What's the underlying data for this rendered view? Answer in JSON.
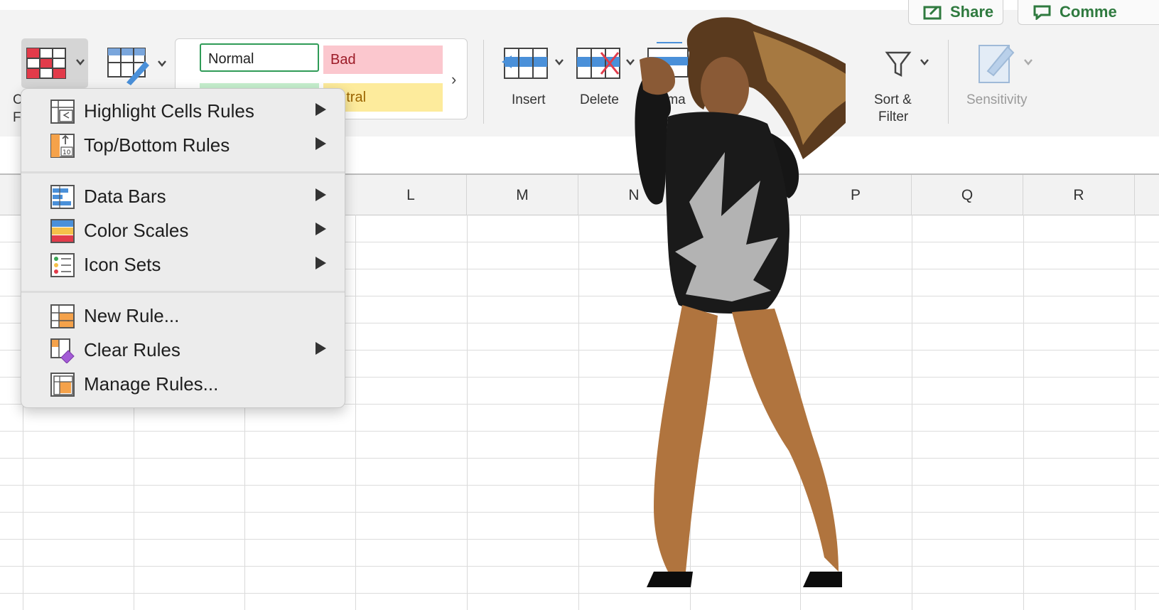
{
  "ribbon": {
    "top_buttons": {
      "share_label": "Share",
      "comments_label": "Comme"
    },
    "conditional_formatting_label_a": "C",
    "conditional_formatting_label_b": "F",
    "styles": {
      "normal": "Normal",
      "bad": "Bad",
      "neutral": "eutral",
      "more": "›"
    },
    "insert_label": "Insert",
    "delete_label": "Delete",
    "format_label": "rma",
    "sort_filter_label_1": "Sort &",
    "sort_filter_label_2": "Filter",
    "sensitivity_label": "Sensitivity"
  },
  "grid": {
    "columns": [
      "L",
      "M",
      "N",
      "P",
      "Q",
      "R"
    ]
  },
  "menu": {
    "items": [
      {
        "label": "Highlight Cells Rules",
        "icon": "highlight-cells-icon",
        "submenu": true
      },
      {
        "label": "Top/Bottom Rules",
        "icon": "top-bottom-icon",
        "submenu": true
      },
      {
        "label": "Data Bars",
        "icon": "data-bars-icon",
        "submenu": true
      },
      {
        "label": "Color Scales",
        "icon": "color-scales-icon",
        "submenu": true
      },
      {
        "label": "Icon Sets",
        "icon": "icon-sets-icon",
        "submenu": true
      },
      {
        "label": "New Rule...",
        "icon": "new-rule-icon",
        "submenu": false
      },
      {
        "label": "Clear Rules",
        "icon": "clear-rules-icon",
        "submenu": true
      },
      {
        "label": "Manage Rules...",
        "icon": "manage-rules-icon",
        "submenu": false
      }
    ]
  },
  "colors": {
    "accent_green": "#2f7a3f",
    "menu_background": "#ececec",
    "bad_fill": "#fbc7ce",
    "neutral_fill": "#fdeb9c"
  }
}
